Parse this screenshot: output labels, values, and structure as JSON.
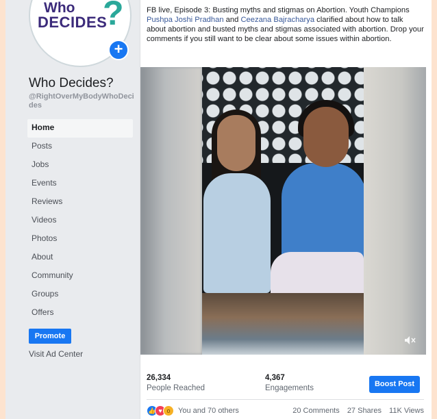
{
  "sidebar": {
    "logo": {
      "top": "Who",
      "bottom": "DECIDES",
      "mark": "?"
    },
    "page_name": "Who Decides?",
    "page_handle": "@RightOverMyBodyWhoDecides",
    "nav": [
      {
        "label": "Home",
        "active": true
      },
      {
        "label": "Posts"
      },
      {
        "label": "Jobs"
      },
      {
        "label": "Events"
      },
      {
        "label": "Reviews"
      },
      {
        "label": "Videos"
      },
      {
        "label": "Photos"
      },
      {
        "label": "About"
      },
      {
        "label": "Community"
      },
      {
        "label": "Groups"
      },
      {
        "label": "Offers"
      }
    ],
    "promote_label": "Promote",
    "ad_center_label": "Visit Ad Center"
  },
  "post": {
    "text_before_1": "FB live, Episode 3: Busting myths and stigmas on Abortion. Youth Champions ",
    "mention_1": "Pushpa Joshi Pradhan",
    "text_between": " and ",
    "mention_2": "Ceezana Bajracharya",
    "text_after": " clarified about how to talk about abortion and busted myths and stigmas associated with abortion. Drop your comments if you still want to be clear about some issues within abortion."
  },
  "insights": {
    "people_reached_value": "26,334",
    "people_reached_label": "People Reached",
    "engagements_value": "4,367",
    "engagements_label": "Engagements",
    "boost_label": "Boost Post"
  },
  "reactions": {
    "icons": [
      "like-icon",
      "love-icon",
      "wow-icon"
    ],
    "summary": "You and 70 others",
    "comments": "20 Comments",
    "shares": "27 Shares",
    "views": "11K Views"
  },
  "colors": {
    "accent": "#1877f2",
    "link": "#385898",
    "background": "#fde3cf"
  }
}
